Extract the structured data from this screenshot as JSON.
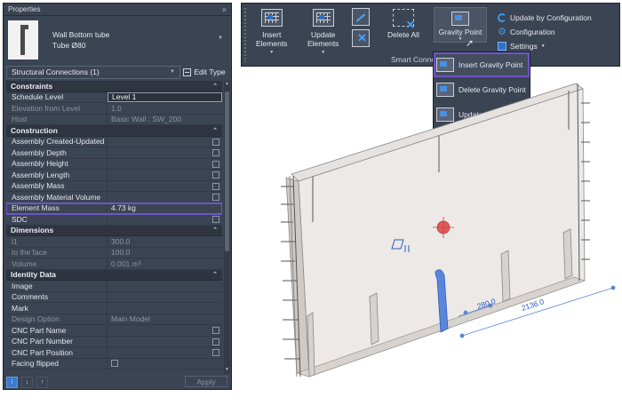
{
  "properties": {
    "title": "Properties",
    "close": "×",
    "type_family": "Wall Bottom tube",
    "type_name": "Tube Ø80",
    "filter": "Structural Connections (1)",
    "edit_type": "Edit Type",
    "apply": "Apply",
    "groups": [
      {
        "name": "Constraints",
        "rows": [
          {
            "key": "Schedule Level",
            "value": "Level 1",
            "editable": true
          },
          {
            "key": "Elevation from Level",
            "value": "1.0",
            "dim": true
          },
          {
            "key": "Host",
            "value": "Basic Wall : SW_200",
            "dim": true
          }
        ]
      },
      {
        "name": "Construction",
        "rows": [
          {
            "key": "Assembly Created-Updated",
            "value": "",
            "check": true
          },
          {
            "key": "Assembly Depth",
            "value": "",
            "check": true
          },
          {
            "key": "Assembly Height",
            "value": "",
            "check": true
          },
          {
            "key": "Assembly Length",
            "value": "",
            "check": true
          },
          {
            "key": "Assembly Mass",
            "value": "",
            "check": true
          },
          {
            "key": "Assembly Material Volume",
            "value": "",
            "check": true
          },
          {
            "key": "Element Mass",
            "value": "4.73 kg",
            "highlight": true
          },
          {
            "key": "SDC",
            "value": "",
            "check": true
          }
        ]
      },
      {
        "name": "Dimensions",
        "rows": [
          {
            "key": "l1",
            "value": "300.0",
            "dim": true
          },
          {
            "key": "to the face",
            "value": "100.0",
            "dim": true
          },
          {
            "key": "Volume",
            "value": "0.001 m³",
            "dim": true
          }
        ]
      },
      {
        "name": "Identity Data",
        "rows": [
          {
            "key": "Image",
            "value": ""
          },
          {
            "key": "Comments",
            "value": ""
          },
          {
            "key": "Mark",
            "value": ""
          },
          {
            "key": "Design Option",
            "value": "Main Model",
            "dim": true
          },
          {
            "key": "CNC Part Name",
            "value": "",
            "check": true
          },
          {
            "key": "CNC Part Number",
            "value": "",
            "check": true
          },
          {
            "key": "CNC Part Position",
            "value": "",
            "check": true
          },
          {
            "key": "Facing flipped",
            "value": "",
            "leftcheck": true
          }
        ]
      }
    ]
  },
  "ribbon": {
    "insert_elements": [
      "Insert",
      "Elements"
    ],
    "update_elements": [
      "Update",
      "Elements"
    ],
    "delete_all": "Delete All",
    "gravity_point": "Gravity Point",
    "update_by_configuration": "Update by Configuration",
    "configuration": "Configuration",
    "settings": "Settings",
    "panel_label": "Smart Conne"
  },
  "dropdown": {
    "items": [
      "Insert Gravity Point",
      "Delete Gravity Point",
      "Update Gravity Point"
    ]
  },
  "viewport": {
    "dim1": "280.0",
    "dim2": "2136.0"
  },
  "colors": {
    "panel_bg": "#3b4453",
    "highlight": "#6e55c8",
    "accent_blue": "#3b9be8",
    "gravity_point": "#e05a5a"
  }
}
